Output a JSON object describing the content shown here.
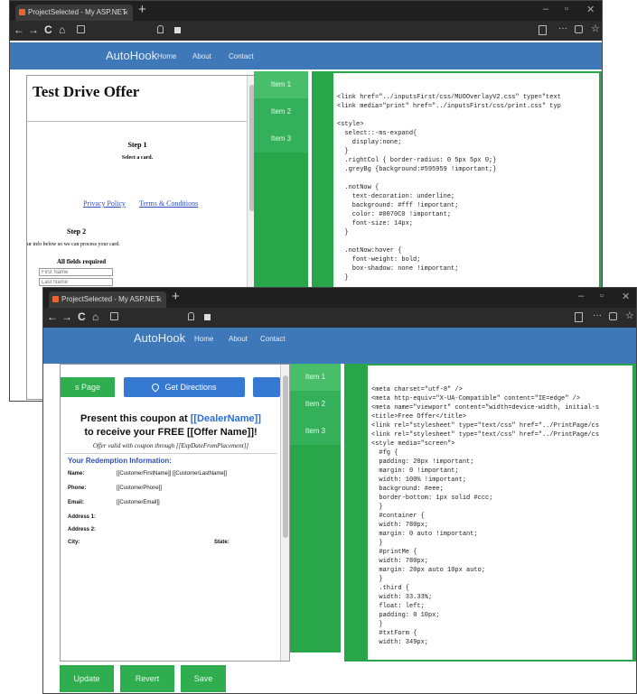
{
  "browser": {
    "tab_title": "ProjectSelected - My ASP.NET",
    "tab_close": "×",
    "new_tab": "+",
    "win_min": "–",
    "win_max": "▫",
    "win_close": "✕",
    "nav_back": "←",
    "nav_forward": "→",
    "nav_reload": "C",
    "nav_home": "⌂",
    "nav_more": "···"
  },
  "site": {
    "brand": "AutoHook",
    "nav": [
      "Home",
      "About",
      "Contact"
    ]
  },
  "menu": {
    "items": [
      "Item 1",
      "Item 2",
      "Item 3"
    ]
  },
  "window1": {
    "heading": "Test Drive Offer",
    "step1_title": "Step 1",
    "step1_sub": "Select a card.",
    "privacy": "Privacy Policy",
    "terms": "Terms & Conditions",
    "step2_title": "Step 2",
    "step2_text": "ur info below so we can process your card.",
    "required": "All fields required",
    "first_name_placeholder": "First Name",
    "last_name_placeholder": "Last Name",
    "code_lines": [
      "<link href=\"../inputsFirst/css/MUOOverlayV2.css\" type=\"text",
      "<link media=\"print\" href=\"../inputsFirst/css/print.css\" typ",
      "",
      "<style>",
      "  select::-ms-expand{",
      "    display:none;",
      "  }",
      "  .rightCol { border-radius: 0 5px 5px 0;}",
      "  .greyBg {background:#595959 !important;}",
      "",
      "  .notNow {",
      "    text-decoration: underline;",
      "    background: #fff !important;",
      "    color: #0070C0 !important;",
      "    font-size: 14px;",
      "  }",
      "",
      "  .notNow:hover {",
      "    font-weight: bold;",
      "    box-shadow: none !important;",
      "  }"
    ]
  },
  "window2": {
    "btn_page": "s Page",
    "btn_directions": "Get Directions",
    "coupon_line1_a": "Present this coupon at ",
    "coupon_line1_b": "[[DealerName]]",
    "coupon_line2": "to receive your FREE [[Offer Name]]!",
    "valid": "Offer valid with coupon through [[ExpDateFromPlacement]]",
    "redemption_title": "Your Redemption Information:",
    "fields": [
      {
        "label": "Name:",
        "value": "[[CustomerFirstName]] [[CustomerLastName]]"
      },
      {
        "label": "Phone:",
        "value": "[[CustomerPhone]]"
      },
      {
        "label": "Email:",
        "value": "[[CustomerEmail]]"
      },
      {
        "label": "Address 1:",
        "value": ""
      },
      {
        "label": "Address 2:",
        "value": ""
      },
      {
        "label": "City:",
        "value": ""
      }
    ],
    "state_label": "State:",
    "bottom_buttons": [
      "Update",
      "Revert",
      "Save"
    ],
    "code_lines": [
      "<meta charset=\"utf-8\" />",
      "<meta http-equiv=\"X-UA-Compatible\" content=\"IE=edge\" />",
      "<meta name=\"viewport\" content=\"width=device-width, initial-s",
      "<title>Free Offer</title>",
      "<link rel=\"stylesheet\" type=\"text/css\" href=\"../PrintPage/cs",
      "<link rel=\"stylesheet\" type=\"text/css\" href=\"../PrintPage/cs",
      "<style media=\"screen\">",
      "  #fg {",
      "  padding: 20px !important;",
      "  margin: 0 !important;",
      "  width: 100% !important;",
      "  background: #eee;",
      "  border-bottom: 1px solid #ccc;",
      "  }",
      "  #container {",
      "  width: 780px;",
      "  margin: 0 auto !important;",
      "  }",
      "  #printMe {",
      "  width: 780px;",
      "  margin: 20px auto 10px auto;",
      "  }",
      "  .third {",
      "  width: 33.33%;",
      "  float: left;",
      "  padding: 0 10px;",
      "  }",
      "  #txtForm {",
      "  width: 349px;"
    ]
  },
  "colors": {
    "site_blue": "#3f78b8",
    "green": "#2aa64a",
    "dealer_blue": "#2b6fd6",
    "redemption_blue": "#2f4fb8"
  }
}
